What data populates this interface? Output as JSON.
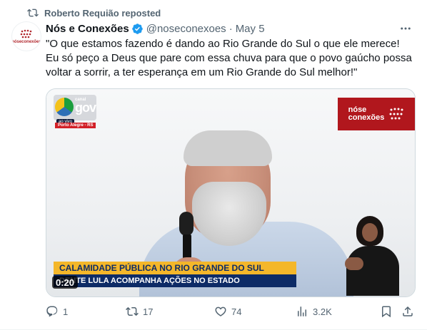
{
  "repost": {
    "icon": "repost-icon",
    "text": "Roberto Requião reposted"
  },
  "tweet": {
    "avatar_text": "nóseconexões",
    "display_name": "Nós e Conexões",
    "handle": "@noseconexoes",
    "separator": "·",
    "date": "May 5",
    "verified": true,
    "text_lines": [
      "\"O que estamos fazendo é dando ao Rio Grande do Sul o que ele merece!",
      "Eu só peço a Deus que pare com essa chuva para que o povo gaúcho possa",
      "voltar a sorrir, a ter esperança em um Rio Grande do Sul melhor!\""
    ]
  },
  "media": {
    "overlay": {
      "canal_label": "canal",
      "gov_label": "gov",
      "ao_vivo": "ao vivo",
      "location": "Porto Alegre - RS",
      "brand_line1": "nóse",
      "brand_line2": "conexões",
      "lower_third_title": "CALAMIDADE PÚBLICA NO RIO GRANDE DO SUL",
      "lower_third_subtitle": "DENTE LULA ACOMPANHA AÇÕES NO ESTADO"
    },
    "timer": "0:20"
  },
  "actions": {
    "replies": "1",
    "reposts": "17",
    "likes": "74",
    "views": "3.2K"
  },
  "colors": {
    "text_primary": "#0f1419",
    "text_secondary": "#536471",
    "verified_blue": "#1d9bf0",
    "brand_red": "#b1171d",
    "lower_third_yellow": "#f4b72a",
    "lower_third_navy": "#0d2b66"
  }
}
